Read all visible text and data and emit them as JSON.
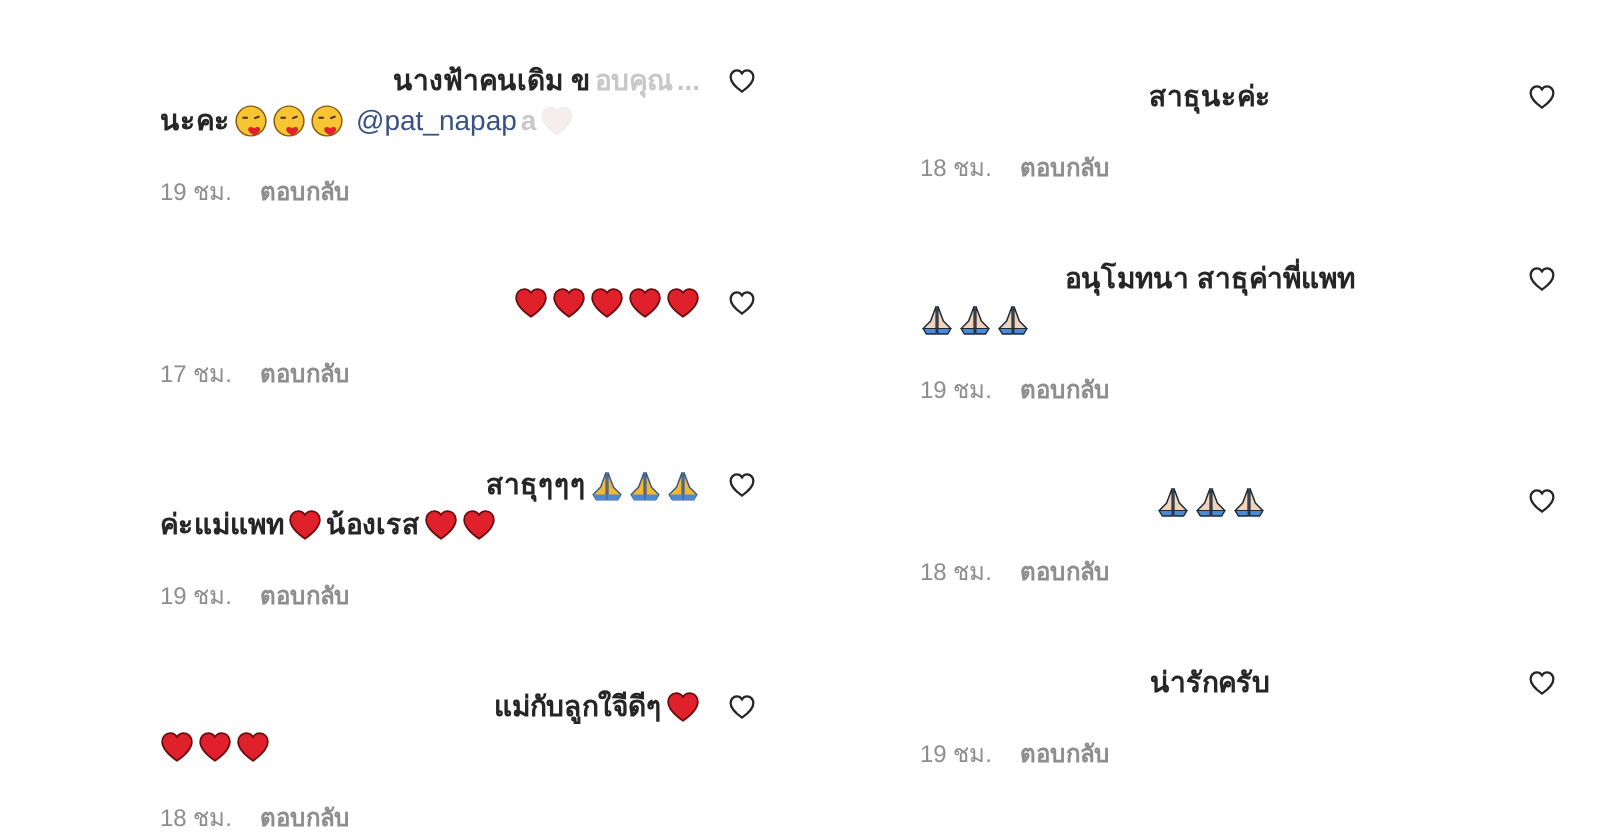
{
  "columns": [
    {
      "comments": [
        {
          "liked": false,
          "lines": [
            [
              {
                "kind": "text",
                "text": "นางฟ้าคนเดิม ข"
              },
              {
                "kind": "faded-text",
                "text": "อบคุณ"
              },
              {
                "kind": "faded-text",
                "text": "..."
              }
            ],
            [
              {
                "kind": "text",
                "text": "นะคะ"
              },
              {
                "kind": "kiss-emoji"
              },
              {
                "kind": "kiss-emoji"
              },
              {
                "kind": "kiss-emoji"
              },
              {
                "kind": "mention",
                "text": "@pat_napap"
              },
              {
                "kind": "faded-text",
                "text": "a"
              },
              {
                "kind": "faded-heart"
              }
            ]
          ],
          "time": "19 ชม.",
          "reply": "ตอบกลับ"
        },
        {
          "liked": false,
          "lines": [
            [
              {
                "kind": "heart-emoji"
              },
              {
                "kind": "heart-emoji"
              },
              {
                "kind": "heart-emoji"
              },
              {
                "kind": "heart-emoji"
              },
              {
                "kind": "heart-emoji"
              }
            ]
          ],
          "time": "17 ชม.",
          "reply": "ตอบกลับ"
        },
        {
          "liked": false,
          "lines": [
            [
              {
                "kind": "text",
                "text": "สาธุๆๆๆ"
              },
              {
                "kind": "pray-emoji"
              },
              {
                "kind": "pray-emoji"
              },
              {
                "kind": "pray-emoji"
              }
            ],
            [
              {
                "kind": "text",
                "text": "ค่ะแม่แพท"
              },
              {
                "kind": "heart-emoji"
              },
              {
                "kind": "text",
                "text": "น้องเรส"
              },
              {
                "kind": "heart-emoji"
              },
              {
                "kind": "heart-emoji"
              }
            ]
          ],
          "time": "19 ชม.",
          "reply": "ตอบกลับ"
        },
        {
          "liked": false,
          "lines": [
            [
              {
                "kind": "text",
                "text": "แม่กับลูกใจีดีๆ"
              },
              {
                "kind": "heart-emoji"
              }
            ],
            [
              {
                "kind": "heart-emoji"
              },
              {
                "kind": "heart-emoji"
              },
              {
                "kind": "heart-emoji"
              }
            ]
          ],
          "time": "18 ชม.",
          "reply": "ตอบกลับ"
        }
      ]
    },
    {
      "comments": [
        {
          "liked": false,
          "lines": [
            [
              {
                "kind": "text",
                "text": "สาธุนะค่ะ"
              }
            ]
          ],
          "time": "18 ชม.",
          "reply": "ตอบกลับ"
        },
        {
          "liked": false,
          "lines": [
            [
              {
                "kind": "text",
                "text": "อนุโมทนา สาธุค่าพี่แพท"
              }
            ],
            [
              {
                "kind": "light-pray-emoji"
              },
              {
                "kind": "light-pray-emoji"
              },
              {
                "kind": "light-pray-emoji"
              }
            ]
          ],
          "time": "19 ชม.",
          "reply": "ตอบกลับ"
        },
        {
          "liked": false,
          "lines": [
            [
              {
                "kind": "light-pray-emoji"
              },
              {
                "kind": "light-pray-emoji"
              },
              {
                "kind": "light-pray-emoji"
              }
            ]
          ],
          "time": "18 ชม.",
          "reply": "ตอบกลับ"
        },
        {
          "liked": false,
          "lines": [
            [
              {
                "kind": "text",
                "text": "น่ารักครับ"
              }
            ]
          ],
          "time": "19 ชม.",
          "reply": "ตอบกลับ"
        }
      ]
    }
  ]
}
